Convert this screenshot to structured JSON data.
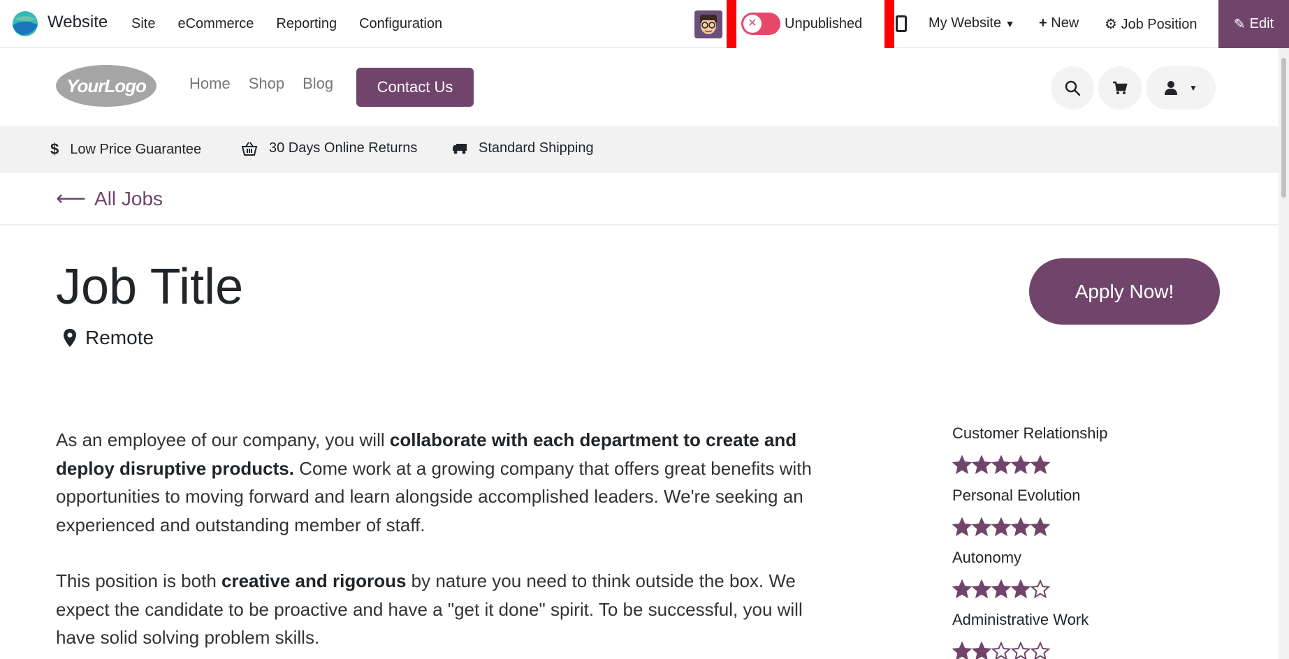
{
  "topbar": {
    "app_name": "Website",
    "menu": [
      "Site",
      "eCommerce",
      "Reporting",
      "Configuration"
    ],
    "publish_status": "Unpublished",
    "my_website": "My Website",
    "new_label": "New",
    "job_position": "Job Position",
    "edit_label": "Edit"
  },
  "header": {
    "logo_text": "YourLogo",
    "nav": [
      "Home",
      "Shop",
      "Blog"
    ],
    "contact_label": "Contact Us"
  },
  "perks": [
    "Low Price Guarantee",
    "30 Days Online Returns",
    "Standard Shipping"
  ],
  "back_label": "All Jobs",
  "job": {
    "title": "Job Title",
    "location": "Remote",
    "apply_label": "Apply Now!"
  },
  "description": {
    "p1_a": "As an employee of our company, you will ",
    "p1_b": "collaborate with each department to create and deploy disruptive products.",
    "p1_c": " Come work at a growing company that offers great benefits with opportunities to moving forward and learn alongside accomplished leaders. We're seeking an experienced and outstanding member of staff.",
    "p2_a": "This position is both ",
    "p2_b": "creative and rigorous",
    "p2_c": " by nature you need to think outside the box. We expect the candidate to be proactive and have a \"get it done\" spirit. To be successful, you will have solid solving problem skills."
  },
  "skills": [
    {
      "label": "Customer Relationship",
      "rating": 5
    },
    {
      "label": "Personal Evolution",
      "rating": 5
    },
    {
      "label": "Autonomy",
      "rating": 4
    },
    {
      "label": "Administrative Work",
      "rating": 2
    }
  ],
  "colors": {
    "brand": "#71456b",
    "toggle_off": "#e8476c",
    "highlight": "#ff0000"
  }
}
